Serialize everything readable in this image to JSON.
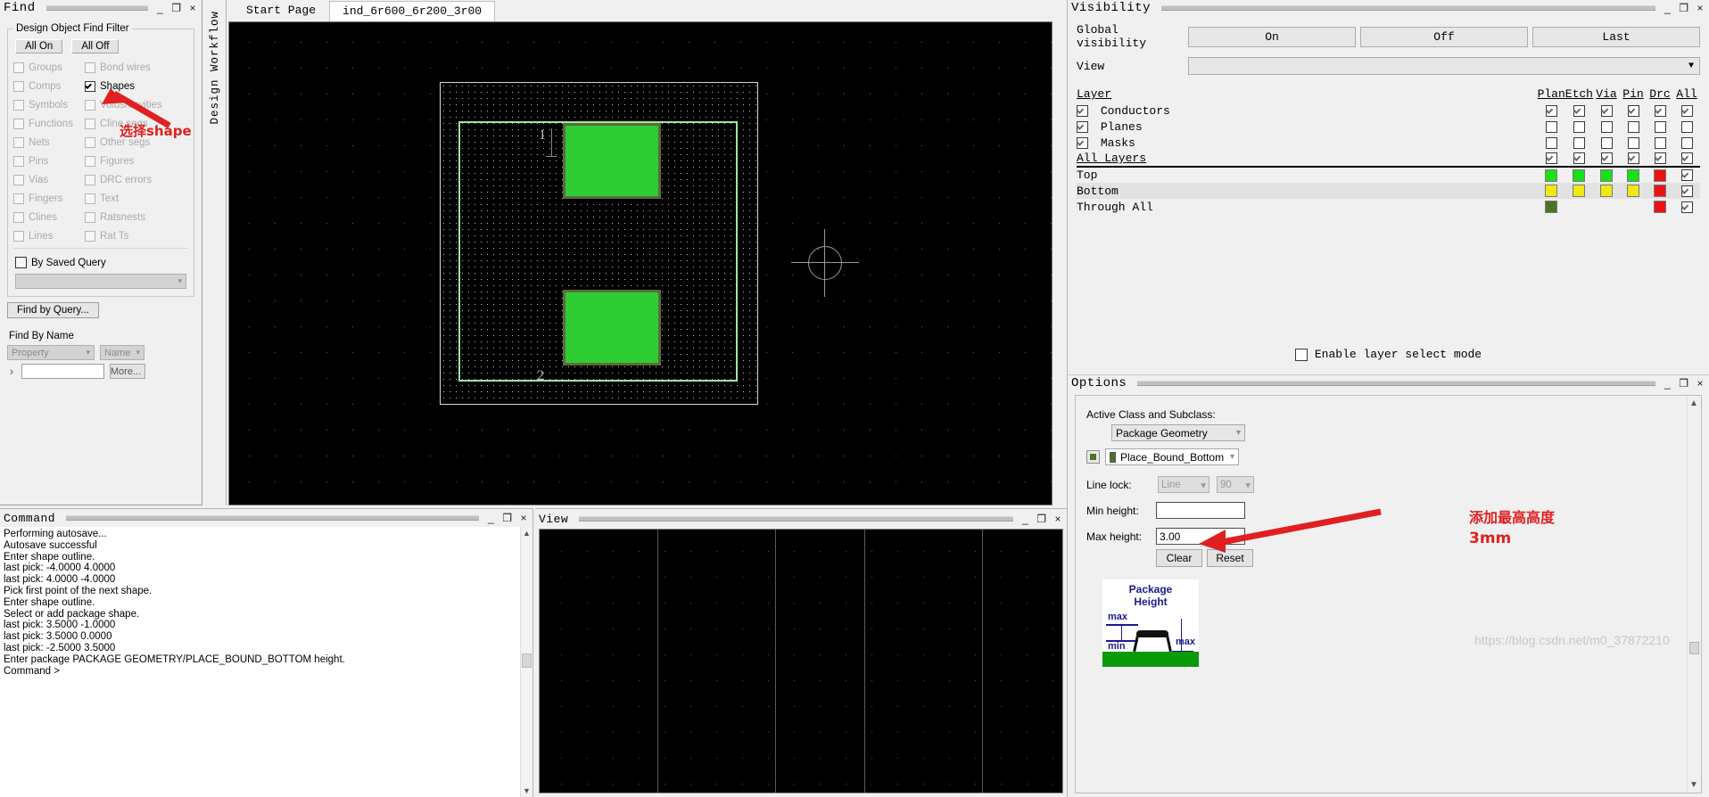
{
  "find": {
    "title": "Find",
    "window_buttons": [
      "_",
      "❐",
      "×"
    ],
    "filter_group_label": "Design Object Find Filter",
    "all_on_label": "All On",
    "all_off_label": "All Off",
    "checkboxes_left": [
      {
        "label": "Groups",
        "checked": false,
        "enabled": false
      },
      {
        "label": "Comps",
        "checked": false,
        "enabled": false
      },
      {
        "label": "Symbols",
        "checked": false,
        "enabled": false
      },
      {
        "label": "Functions",
        "checked": false,
        "enabled": false
      },
      {
        "label": "Nets",
        "checked": false,
        "enabled": false
      },
      {
        "label": "Pins",
        "checked": false,
        "enabled": false
      },
      {
        "label": "Vias",
        "checked": false,
        "enabled": false
      },
      {
        "label": "Fingers",
        "checked": false,
        "enabled": false
      },
      {
        "label": "Clines",
        "checked": false,
        "enabled": false
      },
      {
        "label": "Lines",
        "checked": false,
        "enabled": false
      }
    ],
    "checkboxes_right": [
      {
        "label": "Bond wires",
        "checked": false,
        "enabled": false
      },
      {
        "label": "Shapes",
        "checked": true,
        "enabled": true
      },
      {
        "label": "Voids/cavities",
        "checked": false,
        "enabled": false
      },
      {
        "label": "Cline segs",
        "checked": false,
        "enabled": false
      },
      {
        "label": "Other segs",
        "checked": false,
        "enabled": false
      },
      {
        "label": "Figures",
        "checked": false,
        "enabled": false
      },
      {
        "label": "DRC errors",
        "checked": false,
        "enabled": false
      },
      {
        "label": "Text",
        "checked": false,
        "enabled": false
      },
      {
        "label": "Ratsnests",
        "checked": false,
        "enabled": false
      },
      {
        "label": "Rat Ts",
        "checked": false,
        "enabled": false
      }
    ],
    "by_saved_query_label": "By Saved Query",
    "by_saved_query_checked": false,
    "saved_query_value": "",
    "find_by_query_label": "Find by Query...",
    "find_by_name_label": "Find By Name",
    "property_value": "Property",
    "name_value": "Name",
    "name_input_value": "",
    "more_label": "More...",
    "expander_glyph": "›"
  },
  "workflow_tab": {
    "label": "Design Workflow"
  },
  "tabs": [
    {
      "label": "Start Page",
      "active": false
    },
    {
      "label": "ind_6r600_6r200_3r00",
      "active": true
    }
  ],
  "canvas": {
    "pad_labels": [
      "1",
      "2"
    ],
    "background_color": "#000000",
    "shape_fill_color": "#2ecc33",
    "outline_color": "#9fe79f"
  },
  "visibility": {
    "title": "Visibility",
    "window_buttons": [
      "_",
      "❐",
      "×"
    ],
    "global_visibility_label": "Global visibility",
    "global_buttons": [
      "On",
      "Off",
      "Last"
    ],
    "view_label": "View",
    "view_value": "",
    "columns": [
      "Plan",
      "Etch",
      "Via",
      "Pin",
      "Drc",
      "All"
    ],
    "layer_header": "Layer",
    "rows": [
      {
        "name": "Conductors",
        "has_checkbox": true,
        "checked": true,
        "cells": [
          true,
          true,
          true,
          true,
          true,
          true
        ]
      },
      {
        "name": "Planes",
        "has_checkbox": true,
        "checked": true,
        "cells": [
          false,
          false,
          false,
          false,
          false,
          false
        ]
      },
      {
        "name": "Masks",
        "has_checkbox": true,
        "checked": true,
        "cells": [
          false,
          false,
          false,
          false,
          false,
          false
        ]
      },
      {
        "name": "All Layers",
        "has_checkbox": false,
        "checked": false,
        "cells": [
          true,
          true,
          true,
          true,
          true,
          true
        ]
      }
    ],
    "color_rows": [
      {
        "name": "Top",
        "swatches": [
          "#19e019",
          "#19e019",
          "#19e019",
          "#19e019",
          "#ee1111",
          null
        ],
        "all_checked": true,
        "highlight": false
      },
      {
        "name": "Bottom",
        "swatches": [
          "#f0e813",
          "#f0e813",
          "#f0e813",
          "#f0e813",
          "#ee1111",
          null
        ],
        "all_checked": true,
        "highlight": true
      },
      {
        "name": "Through All",
        "swatches": [
          "#4d7326",
          null,
          null,
          null,
          "#ee1111",
          null
        ],
        "all_checked": true,
        "highlight": false
      }
    ],
    "enable_layer_select_label": "Enable layer select mode",
    "enable_layer_select_checked": false
  },
  "options": {
    "title": "Options",
    "window_buttons": [
      "_",
      "❐",
      "×"
    ],
    "active_class_label": "Active Class and Subclass:",
    "class_value": "Package Geometry",
    "subclass_value": "Place_Bound_Bottom",
    "subclass_color": "#4d7326",
    "line_lock_label": "Line lock:",
    "line_lock_type": "Line",
    "line_lock_angle": "90",
    "min_height_label": "Min height:",
    "min_height_value": "",
    "max_height_label": "Max height:",
    "max_height_value": "3.00",
    "clear_label": "Clear",
    "reset_label": "Reset",
    "package_image": {
      "title_line1": "Package",
      "title_line2": "Height",
      "max_label": "max",
      "min_label": "min",
      "max_label2": "max"
    }
  },
  "command": {
    "title": "Command",
    "window_buttons": [
      "_",
      "❐",
      "×"
    ],
    "lines": [
      "Performing autosave...",
      "Autosave successful",
      "Enter shape outline.",
      "last pick:  -4.0000 4.0000",
      "last pick:  4.0000 -4.0000",
      "Pick first point of the next shape.",
      "Enter shape outline.",
      "Select or add package shape.",
      "last pick:  3.5000 -1.0000",
      "last pick:  3.5000 0.0000",
      "last pick:  -2.5000 3.5000",
      "Enter package PACKAGE GEOMETRY/PLACE_BOUND_BOTTOM height.",
      "Command >"
    ]
  },
  "view_panel": {
    "title": "View",
    "window_buttons": [
      "_",
      "❐",
      "×"
    ]
  },
  "annotations": {
    "shape_note": "选择shape",
    "height_note_line1": "添加最高高度",
    "height_note_line2": "3mm",
    "watermark": "https://blog.csdn.net/m0_37872210",
    "accent_color": "#e02020"
  }
}
